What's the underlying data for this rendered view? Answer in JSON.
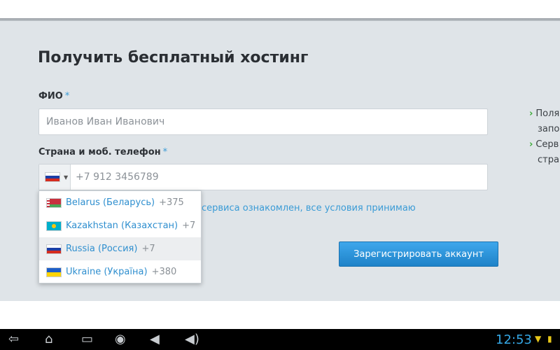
{
  "form": {
    "title": "Получить бесплатный хостинг",
    "required_mark": "*",
    "fio_label": "ФИО",
    "fio_placeholder": "Иванов Иван Иванович",
    "phone_label": "Страна и моб. телефон",
    "phone_placeholder": "+7 912 3456789",
    "terms_text": "сервиса ознакомлен, все условия принимаю",
    "submit_label": "Зарегистрировать аккаунт"
  },
  "country_dropdown": {
    "selected": "Russia (Россия)",
    "items": [
      {
        "name": "Belarus (Беларусь)",
        "code": "+375",
        "flag": "flag-belarus-icon"
      },
      {
        "name": "Kazakhstan (Казахстан)",
        "code": "+7",
        "flag": "flag-kazakhstan-icon"
      },
      {
        "name": "Russia (Россия)",
        "code": "+7",
        "flag": "flag-russia-icon"
      },
      {
        "name": "Ukraine (Україна)",
        "code": "+380",
        "flag": "flag-ukraine-icon"
      }
    ]
  },
  "side_info": {
    "lines": [
      "Поля",
      "запо",
      "Серв",
      "стра"
    ]
  },
  "system_bar": {
    "clock": "12:53",
    "icons": [
      "back-icon",
      "home-icon",
      "recent-apps-icon",
      "camera-icon",
      "volume-down-icon",
      "volume-up-icon",
      "signal-icon",
      "battery-icon"
    ]
  },
  "colors": {
    "accent": "#3a9bd6",
    "button": "#1e82c8",
    "check": "#3aaa35"
  }
}
